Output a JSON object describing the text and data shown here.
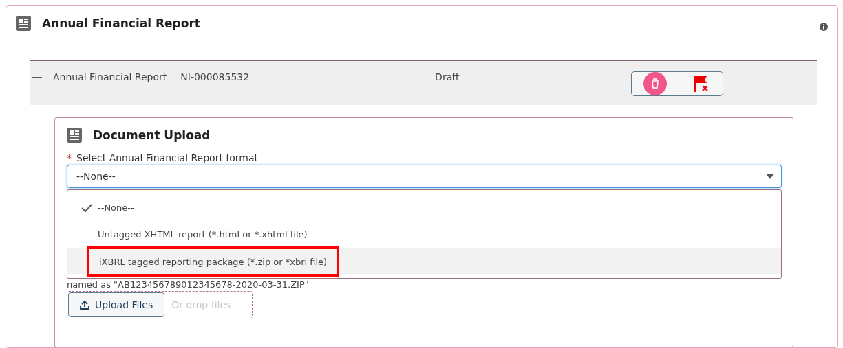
{
  "card": {
    "title": "Annual Financial Report"
  },
  "record": {
    "expanded": true,
    "name": "Annual Financial Report",
    "number": "NI-000085532",
    "status": "Draft"
  },
  "upload": {
    "title": "Document Upload",
    "field_label": "Select Annual Financial Report format",
    "required_mark": "*",
    "value": "--None--",
    "open": true,
    "options": [
      {
        "label": "--None--",
        "selected": true,
        "hovered": false,
        "highlighted": false
      },
      {
        "label": "Untagged XHTML report (*.html or *.xhtml file)",
        "selected": false,
        "hovered": false,
        "highlighted": false
      },
      {
        "label": "iXBRL tagged reporting package (*.zip or *xbri file)",
        "selected": false,
        "hovered": true,
        "highlighted": true
      }
    ],
    "hint": "named as \"AB123456789012345678-2020-03-31.ZIP\"",
    "button": "Upload Files",
    "drop_text": "Or drop files"
  }
}
